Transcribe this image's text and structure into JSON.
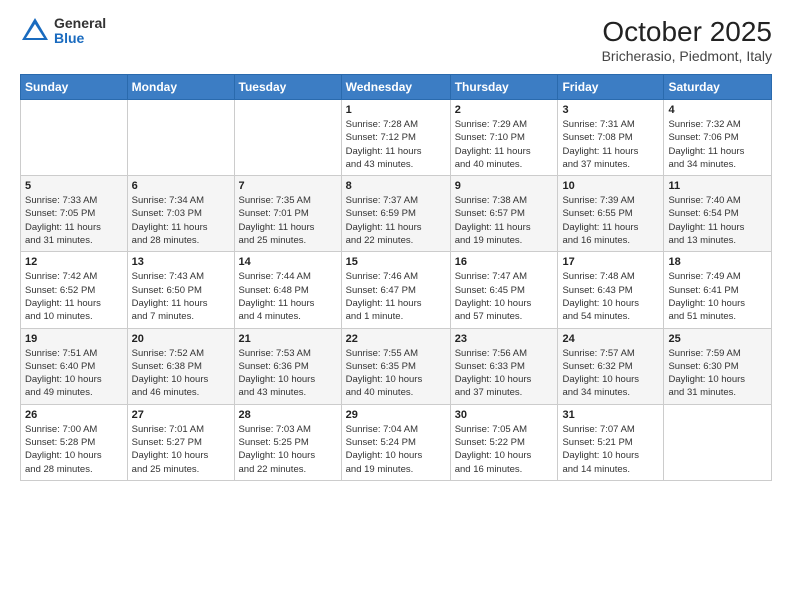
{
  "logo": {
    "general": "General",
    "blue": "Blue"
  },
  "title": "October 2025",
  "subtitle": "Bricherasio, Piedmont, Italy",
  "weekdays": [
    "Sunday",
    "Monday",
    "Tuesday",
    "Wednesday",
    "Thursday",
    "Friday",
    "Saturday"
  ],
  "weeks": [
    [
      {
        "day": "",
        "info": ""
      },
      {
        "day": "",
        "info": ""
      },
      {
        "day": "",
        "info": ""
      },
      {
        "day": "1",
        "info": "Sunrise: 7:28 AM\nSunset: 7:12 PM\nDaylight: 11 hours\nand 43 minutes."
      },
      {
        "day": "2",
        "info": "Sunrise: 7:29 AM\nSunset: 7:10 PM\nDaylight: 11 hours\nand 40 minutes."
      },
      {
        "day": "3",
        "info": "Sunrise: 7:31 AM\nSunset: 7:08 PM\nDaylight: 11 hours\nand 37 minutes."
      },
      {
        "day": "4",
        "info": "Sunrise: 7:32 AM\nSunset: 7:06 PM\nDaylight: 11 hours\nand 34 minutes."
      }
    ],
    [
      {
        "day": "5",
        "info": "Sunrise: 7:33 AM\nSunset: 7:05 PM\nDaylight: 11 hours\nand 31 minutes."
      },
      {
        "day": "6",
        "info": "Sunrise: 7:34 AM\nSunset: 7:03 PM\nDaylight: 11 hours\nand 28 minutes."
      },
      {
        "day": "7",
        "info": "Sunrise: 7:35 AM\nSunset: 7:01 PM\nDaylight: 11 hours\nand 25 minutes."
      },
      {
        "day": "8",
        "info": "Sunrise: 7:37 AM\nSunset: 6:59 PM\nDaylight: 11 hours\nand 22 minutes."
      },
      {
        "day": "9",
        "info": "Sunrise: 7:38 AM\nSunset: 6:57 PM\nDaylight: 11 hours\nand 19 minutes."
      },
      {
        "day": "10",
        "info": "Sunrise: 7:39 AM\nSunset: 6:55 PM\nDaylight: 11 hours\nand 16 minutes."
      },
      {
        "day": "11",
        "info": "Sunrise: 7:40 AM\nSunset: 6:54 PM\nDaylight: 11 hours\nand 13 minutes."
      }
    ],
    [
      {
        "day": "12",
        "info": "Sunrise: 7:42 AM\nSunset: 6:52 PM\nDaylight: 11 hours\nand 10 minutes."
      },
      {
        "day": "13",
        "info": "Sunrise: 7:43 AM\nSunset: 6:50 PM\nDaylight: 11 hours\nand 7 minutes."
      },
      {
        "day": "14",
        "info": "Sunrise: 7:44 AM\nSunset: 6:48 PM\nDaylight: 11 hours\nand 4 minutes."
      },
      {
        "day": "15",
        "info": "Sunrise: 7:46 AM\nSunset: 6:47 PM\nDaylight: 11 hours\nand 1 minute."
      },
      {
        "day": "16",
        "info": "Sunrise: 7:47 AM\nSunset: 6:45 PM\nDaylight: 10 hours\nand 57 minutes."
      },
      {
        "day": "17",
        "info": "Sunrise: 7:48 AM\nSunset: 6:43 PM\nDaylight: 10 hours\nand 54 minutes."
      },
      {
        "day": "18",
        "info": "Sunrise: 7:49 AM\nSunset: 6:41 PM\nDaylight: 10 hours\nand 51 minutes."
      }
    ],
    [
      {
        "day": "19",
        "info": "Sunrise: 7:51 AM\nSunset: 6:40 PM\nDaylight: 10 hours\nand 49 minutes."
      },
      {
        "day": "20",
        "info": "Sunrise: 7:52 AM\nSunset: 6:38 PM\nDaylight: 10 hours\nand 46 minutes."
      },
      {
        "day": "21",
        "info": "Sunrise: 7:53 AM\nSunset: 6:36 PM\nDaylight: 10 hours\nand 43 minutes."
      },
      {
        "day": "22",
        "info": "Sunrise: 7:55 AM\nSunset: 6:35 PM\nDaylight: 10 hours\nand 40 minutes."
      },
      {
        "day": "23",
        "info": "Sunrise: 7:56 AM\nSunset: 6:33 PM\nDaylight: 10 hours\nand 37 minutes."
      },
      {
        "day": "24",
        "info": "Sunrise: 7:57 AM\nSunset: 6:32 PM\nDaylight: 10 hours\nand 34 minutes."
      },
      {
        "day": "25",
        "info": "Sunrise: 7:59 AM\nSunset: 6:30 PM\nDaylight: 10 hours\nand 31 minutes."
      }
    ],
    [
      {
        "day": "26",
        "info": "Sunrise: 7:00 AM\nSunset: 5:28 PM\nDaylight: 10 hours\nand 28 minutes."
      },
      {
        "day": "27",
        "info": "Sunrise: 7:01 AM\nSunset: 5:27 PM\nDaylight: 10 hours\nand 25 minutes."
      },
      {
        "day": "28",
        "info": "Sunrise: 7:03 AM\nSunset: 5:25 PM\nDaylight: 10 hours\nand 22 minutes."
      },
      {
        "day": "29",
        "info": "Sunrise: 7:04 AM\nSunset: 5:24 PM\nDaylight: 10 hours\nand 19 minutes."
      },
      {
        "day": "30",
        "info": "Sunrise: 7:05 AM\nSunset: 5:22 PM\nDaylight: 10 hours\nand 16 minutes."
      },
      {
        "day": "31",
        "info": "Sunrise: 7:07 AM\nSunset: 5:21 PM\nDaylight: 10 hours\nand 14 minutes."
      },
      {
        "day": "",
        "info": ""
      }
    ]
  ]
}
